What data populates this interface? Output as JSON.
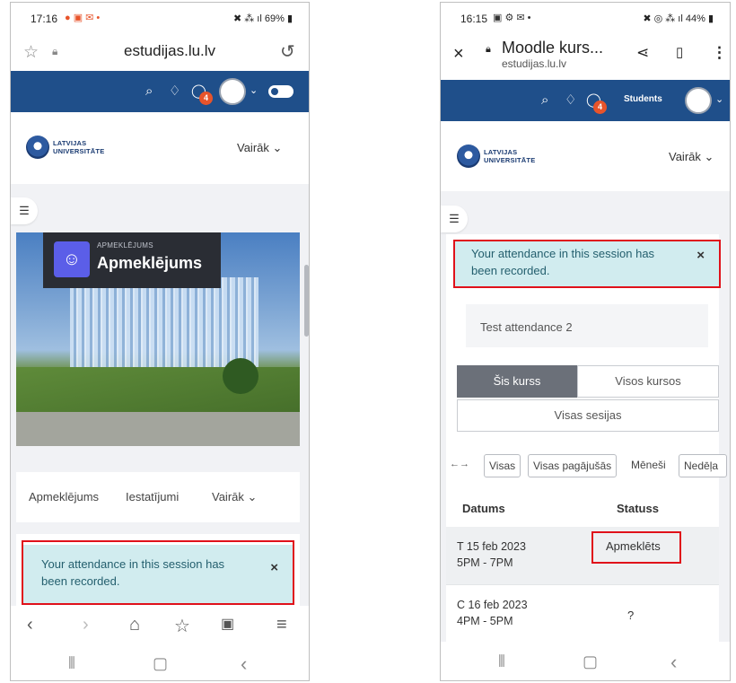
{
  "left_phone": {
    "status_bar": {
      "time": "17:16",
      "battery": "69%"
    },
    "url_bar": {
      "domain": "estudijas.lu.lv"
    },
    "nav": {
      "messages_badge": "4"
    },
    "brand": {
      "logo_line1": "LATVIJAS",
      "logo_line2": "UNIVERSITĀTE",
      "more_label": "Vairāk ⌄"
    },
    "activity": {
      "category": "APMEKLĒJUMS",
      "title": "Apmeklējums"
    },
    "tabs": [
      {
        "label": "Apmeklējums"
      },
      {
        "label": "Iestatījumi"
      },
      {
        "label": "Vairāk ⌄"
      }
    ],
    "alert": {
      "message": "Your attendance in this session has been recorded.",
      "close": "×"
    }
  },
  "right_phone": {
    "status_bar": {
      "time": "16:15",
      "battery": "44%"
    },
    "url_bar": {
      "page_title": "Moodle kurs...",
      "domain": "estudijas.lu.lv"
    },
    "nav": {
      "messages_badge": "4",
      "role_label": "Students"
    },
    "brand": {
      "logo_line1": "LATVIJAS",
      "logo_line2": "UNIVERSITĀTE",
      "more_label": "Vairāk ⌄"
    },
    "alert": {
      "message": "Your attendance in this session has been recorded.",
      "close": "×"
    },
    "session_name": "Test attendance 2",
    "scope_tabs": {
      "this_course": "Šis kurss",
      "all_courses": "Visos kursos",
      "all_sessions": "Visas sesijas"
    },
    "filters": {
      "arrow": "←→",
      "all": "Visas",
      "all_past": "Visas pagājušās",
      "months": "Mēneši",
      "weeks": "Nedēļa"
    },
    "table": {
      "headers": {
        "date": "Datums",
        "status": "Statuss"
      },
      "rows": [
        {
          "date": "T 15 feb 2023",
          "time": "5PM - 7PM",
          "status": "Apmeklēts"
        },
        {
          "date": "C 16 feb 2023",
          "time": "4PM - 5PM",
          "status": "?"
        }
      ]
    }
  }
}
